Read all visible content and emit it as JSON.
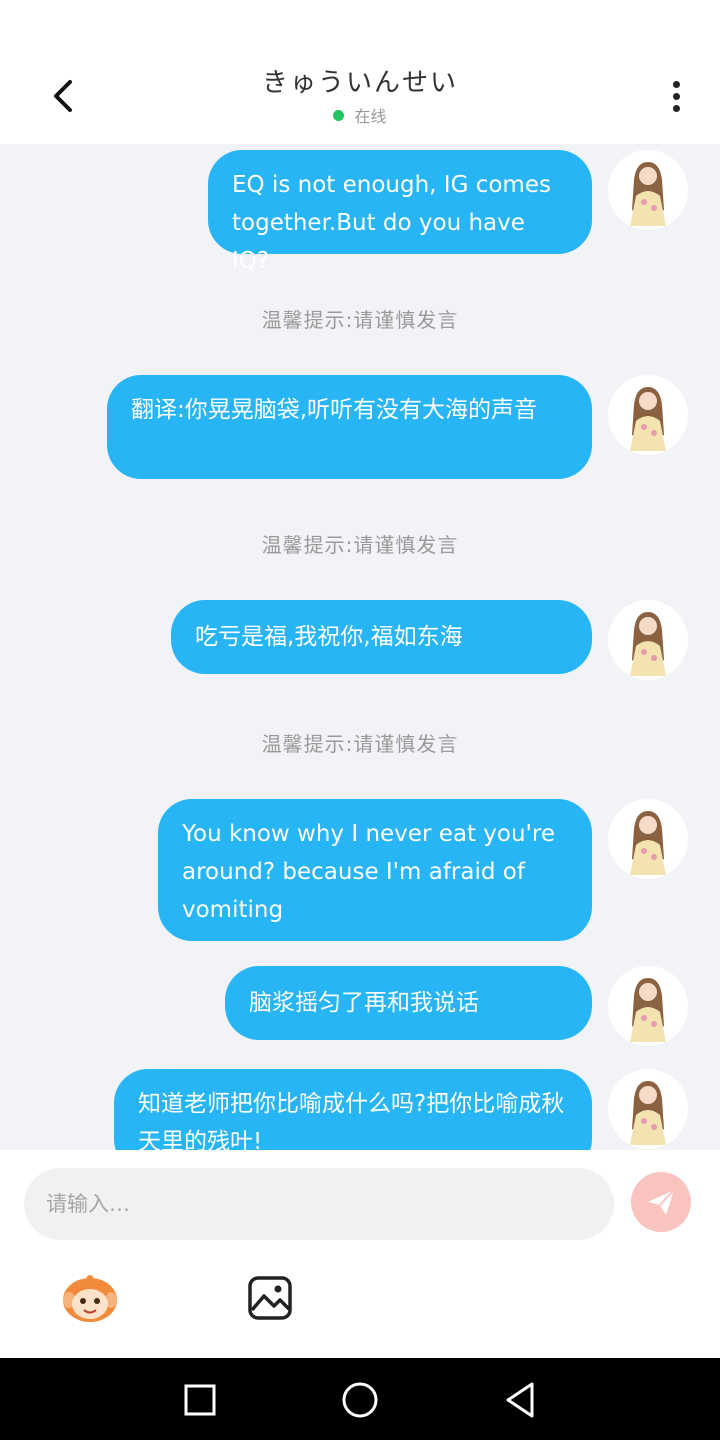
{
  "header": {
    "title": "きゅういんせい",
    "status": "在线"
  },
  "messages": [
    {
      "text": "EQ is not enough, IG comes together.But do you have IQ?"
    },
    {
      "text": "翻译:你晃晃脑袋,听听有没有大海的声音"
    },
    {
      "text": "吃亏是福,我祝你,福如东海"
    },
    {
      "text": " You know why I never eat you're around? because I'm afraid of vomiting"
    },
    {
      "text": "脑浆摇匀了再和我说话"
    },
    {
      "text": "知道老师把你比喻成什么吗?把你比喻成秋天里的残叶!"
    }
  ],
  "tips": [
    "温馨提示:请谨慎发言",
    "温馨提示:请谨慎发言",
    "温馨提示:请谨慎发言"
  ],
  "input": {
    "placeholder": "请输入…"
  },
  "icons": {
    "back": "back-arrow-icon",
    "more": "more-vertical-icon",
    "send": "send-plane-icon",
    "emoji": "emoji-monkey-icon",
    "image": "image-icon",
    "nav_recent": "square-icon",
    "nav_home": "circle-icon",
    "nav_back": "triangle-back-icon"
  },
  "colors": {
    "bubble": "#27b5f5",
    "online": "#22c55e",
    "send_button": "#f9c4c0",
    "chat_background": "#f2f3f7"
  }
}
